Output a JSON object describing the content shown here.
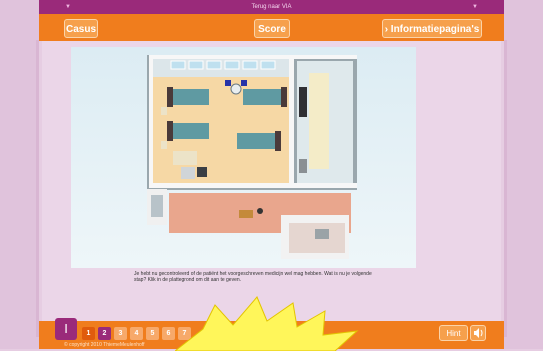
{
  "topbar": {
    "back_label": "Terug naar VIA"
  },
  "tabs": {
    "casus": "Casus",
    "score": "Score",
    "info": "› Informatiepagina's"
  },
  "content": {
    "instruction": "Je hebt nu gecontroleerd of de patiënt het voorgeschreven medicijn wel mag hebben. Wat is nu je volgende stap? Klik in de plattegrond om dit aan te geven."
  },
  "footer": {
    "roman": "I",
    "pages": [
      "1",
      "2",
      "3",
      "4",
      "5",
      "6",
      "7"
    ],
    "current_page": "2",
    "selected_page": "1",
    "copyright": "© copyright 2010 ThiemeMeulenhoff",
    "hint_label": "Hint"
  },
  "colors": {
    "purple": "#9a2a7a",
    "orange": "#f07d1d",
    "pink_bg": "#e6cde2"
  },
  "icons": [
    "speaker-icon",
    "starburst-icon"
  ]
}
